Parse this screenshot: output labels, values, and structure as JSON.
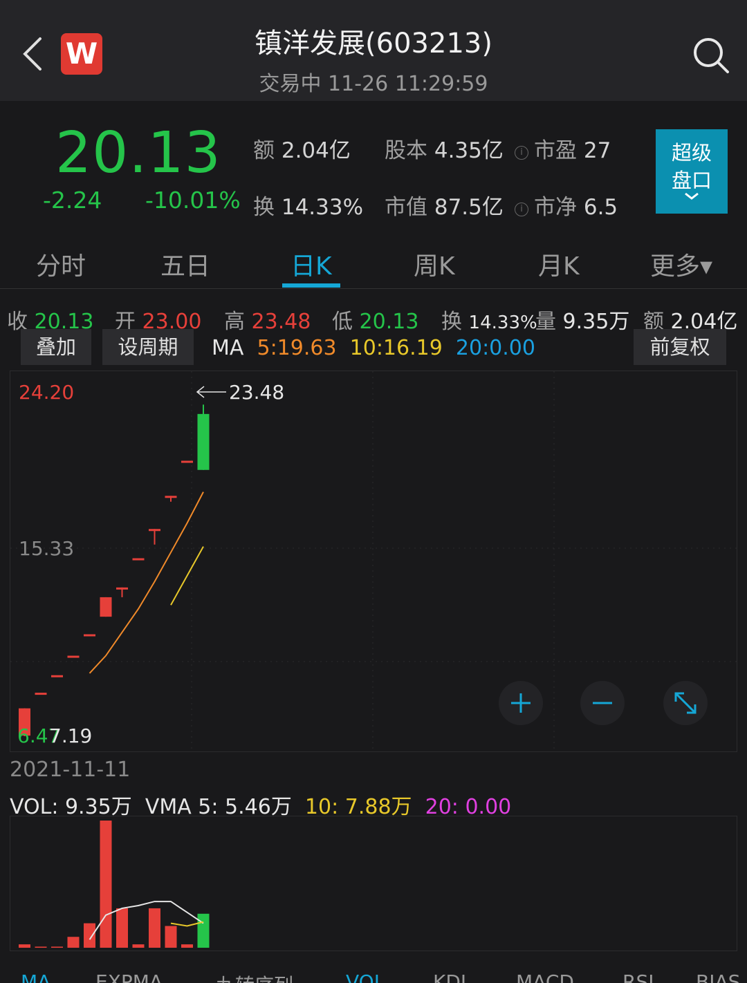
{
  "header": {
    "logo_letter": "W",
    "title": "镇洋发展(603213)",
    "subtitle": "交易中 11-26 11:29:59"
  },
  "quote": {
    "price": "20.13",
    "change": "-2.24",
    "change_pct": "-10.01%",
    "amount_label": "额",
    "amount": "2.04亿",
    "share_label": "股本",
    "share": "4.35亿",
    "pe_label": "市盈",
    "pe": "27",
    "turnover_label": "换",
    "turnover": "14.33%",
    "mcap_label": "市值",
    "mcap": "87.5亿",
    "pb_label": "市净",
    "pb": "6.5",
    "info_icon_glyph": "i",
    "super_panel_line1": "超级",
    "super_panel_line2": "盘口"
  },
  "tabs": [
    {
      "label": "分时"
    },
    {
      "label": "五日"
    },
    {
      "label": "日K"
    },
    {
      "label": "周K"
    },
    {
      "label": "月K"
    },
    {
      "label": "更多▾"
    }
  ],
  "kline_stats": {
    "close_label": "收",
    "close": "20.13",
    "open_label": "开",
    "open": "23.00",
    "high_label": "高",
    "high": "23.48",
    "low_label": "低",
    "low": "20.13",
    "turnover_label": "换",
    "turnover": "14.33%",
    "volume_label": "量",
    "volume": "9.35万",
    "amount_label": "额",
    "amount": "2.04亿"
  },
  "buttons": {
    "overlay": "叠加",
    "set_period": "设周期",
    "adjust": "前复权"
  },
  "ma": {
    "label": "MA",
    "ma5": "5:19.63",
    "ma10": "10:16.19",
    "ma20": "20:0.00"
  },
  "chart_labels": {
    "y_top": "24.20",
    "y_mid": "15.33",
    "y_bottom": "6.47",
    "low_mark": "7.19",
    "high_mark": "23.48",
    "date": "2021-11-11"
  },
  "vol_row": {
    "vol": "VOL: 9.35万",
    "vma5": "VMA 5: 5.46万",
    "vma10": "10: 7.88万",
    "vma20": "20: 0.00"
  },
  "bottom_tabs": [
    {
      "label": "MA"
    },
    {
      "label": "EXPMA"
    },
    {
      "label": "九转序列"
    },
    {
      "label": "VOL"
    },
    {
      "label": "KDJ"
    },
    {
      "label": "MACD"
    },
    {
      "label": "RSI"
    },
    {
      "label": "BIAS"
    }
  ],
  "colors": {
    "up": "#e6403a",
    "down": "#25c44a",
    "accent": "#15a7d6",
    "ma5": "#f08a2a",
    "ma10": "#e8c82a",
    "ma20": "#1aa0e0"
  },
  "chart_data": {
    "type": "candlestick",
    "y_axis": {
      "min": 6.47,
      "max": 24.2,
      "ticks": [
        "24.20",
        "15.33",
        "6.47"
      ]
    },
    "candles": [
      {
        "open": 6.5,
        "close": 7.9,
        "high": 7.9,
        "low": 6.47
      },
      {
        "open": 8.7,
        "close": 8.7,
        "high": 8.7,
        "low": 8.7
      },
      {
        "open": 9.6,
        "close": 9.6,
        "high": 9.6,
        "low": 9.6
      },
      {
        "open": 10.6,
        "close": 10.6,
        "high": 10.6,
        "low": 10.6
      },
      {
        "open": 11.7,
        "close": 11.7,
        "high": 11.7,
        "low": 11.7
      },
      {
        "open": 12.6,
        "close": 13.6,
        "high": 13.6,
        "low": 12.6
      },
      {
        "open": 14.1,
        "close": 14.1,
        "high": 14.1,
        "low": 13.6
      },
      {
        "open": 15.6,
        "close": 15.6,
        "high": 15.6,
        "low": 15.6
      },
      {
        "open": 17.1,
        "close": 17.1,
        "high": 17.1,
        "low": 16.3
      },
      {
        "open": 18.8,
        "close": 18.8,
        "high": 18.8,
        "low": 18.5
      },
      {
        "open": 20.6,
        "close": 20.6,
        "high": 20.6,
        "low": 20.6
      },
      {
        "open": 23.0,
        "close": 20.13,
        "high": 23.48,
        "low": 20.13
      }
    ],
    "ma5": [
      null,
      null,
      null,
      null,
      9.7,
      10.6,
      11.8,
      13.0,
      14.4,
      15.9,
      17.4,
      19.0
    ],
    "ma10": [
      null,
      null,
      null,
      null,
      null,
      null,
      null,
      null,
      null,
      13.2,
      14.7,
      16.2
    ],
    "volume": {
      "values": [
        0.25,
        0.08,
        0.08,
        0.8,
        1.8,
        9.35,
        2.9,
        0.25,
        2.9,
        1.6,
        0.25,
        2.5
      ],
      "vma5": [
        null,
        null,
        null,
        null,
        0.6,
        2.4,
        2.9,
        3.1,
        3.4,
        3.4,
        2.6,
        1.8
      ],
      "vma10": [
        null,
        null,
        null,
        null,
        null,
        null,
        null,
        null,
        null,
        1.8,
        1.6,
        1.9
      ]
    }
  }
}
